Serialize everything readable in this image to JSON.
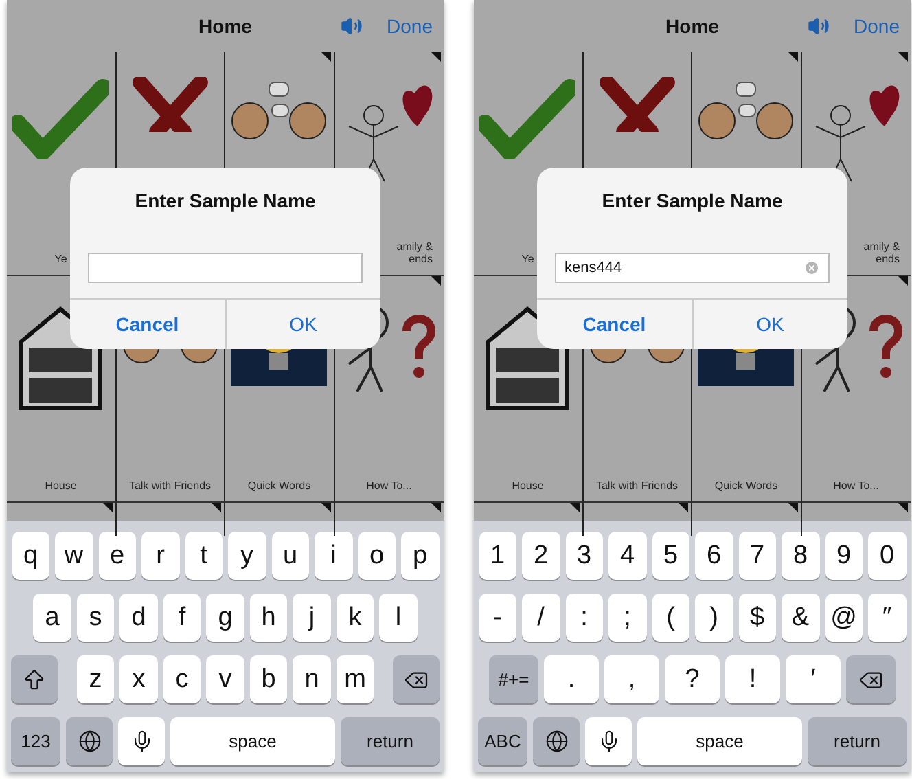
{
  "phones": [
    {
      "nav": {
        "title": "Home",
        "done": "Done"
      },
      "tiles": [
        {
          "label": "Ye",
          "folder": false
        },
        {
          "folder": false
        },
        {
          "folder": true
        },
        {
          "label": "amily &\nends",
          "folder": true
        },
        {
          "label": "House",
          "folder": false
        },
        {
          "label": "Talk with Friends",
          "folder": false
        },
        {
          "label": "Quick Words",
          "folder": false
        },
        {
          "label": "How To...",
          "folder": true
        }
      ],
      "next_row": [
        {
          "folder": true
        },
        {
          "folder": true
        },
        {
          "folder": true
        },
        {
          "folder": true
        }
      ],
      "dialog": {
        "title": "Enter Sample Name",
        "buttons": [
          {
            "label": "Cancel",
            "bold": true
          },
          {
            "label": "OK",
            "bold": false
          }
        ]
      },
      "keyboard": {
        "rows": [
          {
            "keys": [
              {
                "kind": "char",
                "label": "q"
              },
              {
                "kind": "char",
                "label": "w"
              },
              {
                "kind": "char",
                "label": "e"
              },
              {
                "kind": "char",
                "label": "r"
              },
              {
                "kind": "char",
                "label": "t"
              },
              {
                "kind": "char",
                "label": "y"
              },
              {
                "kind": "char",
                "label": "u"
              },
              {
                "kind": "char",
                "label": "i"
              },
              {
                "kind": "char",
                "label": "o"
              },
              {
                "kind": "char",
                "label": "p"
              }
            ]
          },
          {
            "keys": [
              {
                "kind": "char",
                "label": "a"
              },
              {
                "kind": "char",
                "label": "s"
              },
              {
                "kind": "char",
                "label": "d"
              },
              {
                "kind": "char",
                "label": "f"
              },
              {
                "kind": "char",
                "label": "g"
              },
              {
                "kind": "char",
                "label": "h"
              },
              {
                "kind": "char",
                "label": "j"
              },
              {
                "kind": "char",
                "label": "k"
              },
              {
                "kind": "char",
                "label": "l"
              }
            ]
          },
          {
            "keys": [
              {
                "kind": "shift"
              },
              {
                "kind": "char",
                "label": "z"
              },
              {
                "kind": "char",
                "label": "x"
              },
              {
                "kind": "char",
                "label": "c"
              },
              {
                "kind": "char",
                "label": "v"
              },
              {
                "kind": "char",
                "label": "b"
              },
              {
                "kind": "char",
                "label": "n"
              },
              {
                "kind": "char",
                "label": "m"
              },
              {
                "kind": "delete"
              }
            ]
          },
          {
            "keys": [
              {
                "kind": "mode",
                "label": "123"
              },
              {
                "kind": "globe"
              },
              {
                "kind": "mic"
              },
              {
                "kind": "space",
                "label": "space"
              },
              {
                "kind": "return",
                "label": "return"
              }
            ]
          }
        ]
      }
    },
    {
      "nav": {
        "title": "Home",
        "done": "Done"
      },
      "tiles": [
        {
          "label": "Ye",
          "folder": false
        },
        {
          "folder": false
        },
        {
          "folder": true
        },
        {
          "label": "amily &\nends",
          "folder": true
        },
        {
          "label": "House",
          "folder": false
        },
        {
          "label": "Talk with Friends",
          "folder": false
        },
        {
          "label": "Quick Words",
          "folder": false
        },
        {
          "label": "How To...",
          "folder": true
        }
      ],
      "next_row": [
        {
          "folder": true
        },
        {
          "folder": true
        },
        {
          "folder": true
        },
        {
          "folder": true
        }
      ],
      "dialog": {
        "title": "Enter Sample Name",
        "field": {
          "value": "kens444"
        },
        "buttons": [
          {
            "label": "Cancel",
            "bold": true
          },
          {
            "label": "OK",
            "bold": false
          }
        ]
      },
      "keyboard": {
        "rows": [
          {
            "keys": [
              {
                "kind": "char",
                "label": "1"
              },
              {
                "kind": "char",
                "label": "2"
              },
              {
                "kind": "char",
                "label": "3"
              },
              {
                "kind": "char",
                "label": "4"
              },
              {
                "kind": "char",
                "label": "5"
              },
              {
                "kind": "char",
                "label": "6"
              },
              {
                "kind": "char",
                "label": "7"
              },
              {
                "kind": "char",
                "label": "8"
              },
              {
                "kind": "char",
                "label": "9"
              },
              {
                "kind": "char",
                "label": "0"
              }
            ]
          },
          {
            "keys": [
              {
                "kind": "char",
                "label": "-"
              },
              {
                "kind": "char",
                "label": "/"
              },
              {
                "kind": "char",
                "label": ":"
              },
              {
                "kind": "char",
                "label": ";"
              },
              {
                "kind": "char",
                "label": "("
              },
              {
                "kind": "char",
                "label": ")"
              },
              {
                "kind": "char",
                "label": "$"
              },
              {
                "kind": "char",
                "label": "&"
              },
              {
                "kind": "char",
                "label": "@"
              },
              {
                "kind": "char",
                "label": "″"
              }
            ]
          },
          {
            "keys": [
              {
                "kind": "mode",
                "label": "#+="
              },
              {
                "kind": "char",
                "label": "."
              },
              {
                "kind": "char",
                "label": ","
              },
              {
                "kind": "char",
                "label": "?"
              },
              {
                "kind": "char",
                "label": "!"
              },
              {
                "kind": "char",
                "label": "′"
              },
              {
                "kind": "delete"
              }
            ]
          },
          {
            "keys": [
              {
                "kind": "mode",
                "label": "ABC"
              },
              {
                "kind": "globe"
              },
              {
                "kind": "mic"
              },
              {
                "kind": "space",
                "label": "space"
              },
              {
                "kind": "return",
                "label": "return"
              }
            ]
          }
        ]
      }
    }
  ]
}
